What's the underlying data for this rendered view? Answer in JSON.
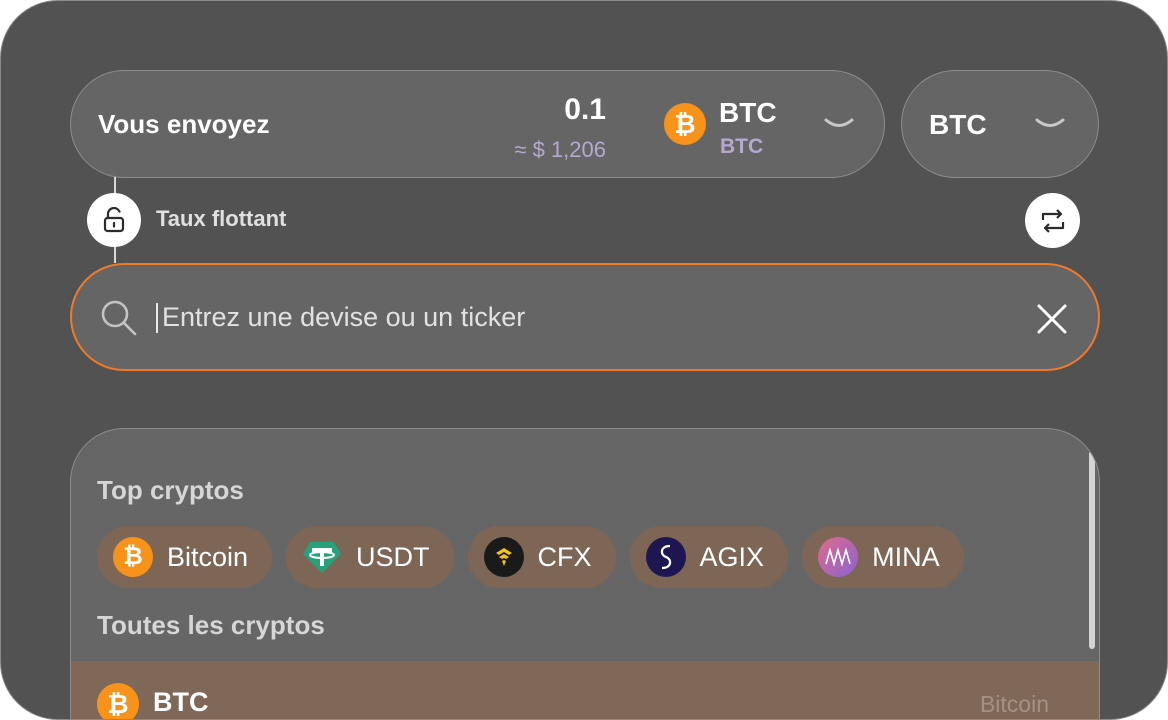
{
  "send": {
    "label": "Vous envoyez",
    "amount": "0.1",
    "amount_usd": "≈ $ 1,206",
    "coin_ticker": "BTC",
    "coin_network": "BTC",
    "coin_icon": "bitcoin-icon"
  },
  "network": {
    "label": "BTC"
  },
  "rate": {
    "label": "Taux flottant",
    "lock_icon": "unlock-icon",
    "swap_icon": "swap-icon"
  },
  "search": {
    "placeholder": "Entrez une devise ou un ticker",
    "value": "",
    "border_color": "#f07a2a"
  },
  "list": {
    "top_title": "Top cryptos",
    "all_title": "Toutes les cryptos",
    "top": [
      {
        "label": "Bitcoin",
        "icon": "bitcoin-icon"
      },
      {
        "label": "USDT",
        "icon": "tether-icon"
      },
      {
        "label": "CFX",
        "icon": "conflux-icon"
      },
      {
        "label": "AGIX",
        "icon": "singularitynet-icon"
      },
      {
        "label": "MINA",
        "icon": "mina-icon"
      }
    ],
    "rows": [
      {
        "ticker": "BTC",
        "name": "Bitcoin",
        "icon": "bitcoin-icon"
      }
    ]
  },
  "colors": {
    "accent": "#f07a2a",
    "bitcoin": "#f7931a",
    "tether": "#26a17b",
    "muted_text": "#b6a9cf"
  }
}
